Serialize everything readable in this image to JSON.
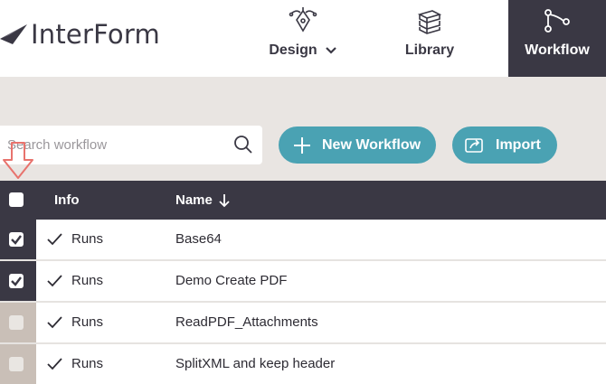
{
  "header": {
    "logo_text": "InterForm",
    "nav": [
      {
        "label": "Design",
        "icon": "pen-tool-icon"
      },
      {
        "label": "Library",
        "icon": "books-icon"
      },
      {
        "label": "Workflow",
        "icon": "workflow-icon"
      }
    ],
    "active_nav": "Workflow"
  },
  "toolbar": {
    "search_placeholder": "Search workflow",
    "new_label": "New Workflow",
    "import_label": "Import"
  },
  "table": {
    "columns": {
      "info": "Info",
      "name": "Name"
    },
    "rows": [
      {
        "status": "Runs",
        "name": "Base64",
        "checked": true
      },
      {
        "status": "Runs",
        "name": "Demo Create PDF",
        "checked": true
      },
      {
        "status": "Runs",
        "name": "ReadPDF_Attachments",
        "checked": false
      },
      {
        "status": "Runs",
        "name": "SplitXML and keep header",
        "checked": false
      }
    ]
  },
  "colors": {
    "dark": "#3a3844",
    "accent": "#4aa2b3",
    "background": "#e9e5e2",
    "annotation": "#e8736d"
  }
}
